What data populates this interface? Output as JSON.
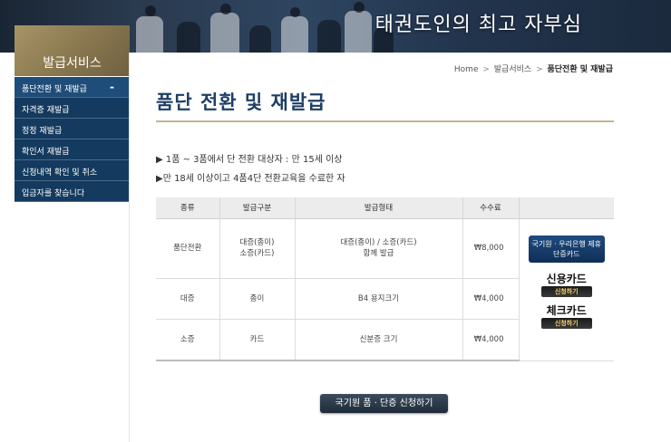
{
  "banner": {
    "title": "태권도인의 최고 자부심"
  },
  "sidebar": {
    "heading": "발급서비스",
    "items": [
      {
        "label": "품단전환 및 재발급",
        "active": true
      },
      {
        "label": "자격증 재발급",
        "active": false
      },
      {
        "label": "정정 재발급",
        "active": false
      },
      {
        "label": "확인서 재발급",
        "active": false
      },
      {
        "label": "신청내역 확인 및 취소",
        "active": false
      },
      {
        "label": "입금자를 찾습니다",
        "active": false
      }
    ],
    "active_marker": "-"
  },
  "breadcrumb": {
    "home": "Home",
    "section": "발급서비스",
    "current": "품단전환 및 재발급",
    "separator": ">"
  },
  "page": {
    "title": "품단 전환 및 재발급"
  },
  "notes": [
    "▶ 1품 ~ 3품에서 단 전환 대상자 : 만 15세 이상",
    "▶만 18세 이상이고 4품4단 전환교육을 수료한 자"
  ],
  "table": {
    "headers": [
      "종류",
      "발급구분",
      "발급형태",
      "수수료",
      ""
    ],
    "rows": [
      {
        "type": "품단전환",
        "division_line1": "대증(종이)",
        "division_line2": "소증(카드)",
        "form_line1": "대증(종이) / 소증(카드)",
        "form_line2": "함께 발급",
        "fee": "₩8,000"
      },
      {
        "type": "대증",
        "division_line1": "종이",
        "division_line2": "",
        "form_line1": "B4 용지크기",
        "form_line2": "",
        "fee": "₩4,000"
      },
      {
        "type": "소증",
        "division_line1": "카드",
        "division_line2": "",
        "form_line1": "신분증 크기",
        "form_line2": "",
        "fee": "₩4,000"
      }
    ]
  },
  "payment": {
    "bank_card_line1": "국기원 · 우리은행 제휴",
    "bank_card_line2": "단증카드",
    "credit_card": "신용카드",
    "check_card": "체크카드",
    "apply_label": "신청하기"
  },
  "main_button": {
    "label": "국기원 품 · 단증 신청하기"
  },
  "colors": {
    "sidebar_bg": "#143a5f",
    "title": "#1d3f66",
    "accent_rule": "#c4b590",
    "button": "#1f2c3a"
  }
}
